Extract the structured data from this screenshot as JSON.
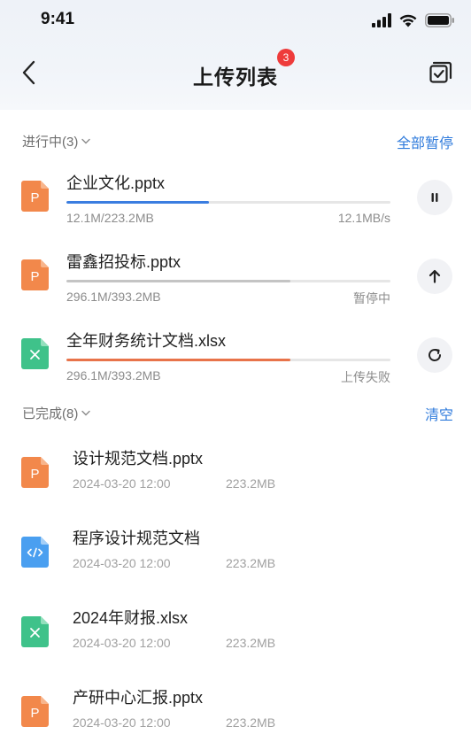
{
  "status_bar": {
    "time": "9:41"
  },
  "header": {
    "title": "上传列表",
    "badge_count": "3"
  },
  "in_progress": {
    "title": "进行中(3)",
    "action": "全部暂停",
    "items": [
      {
        "name": "企业文化.pptx",
        "type": "ppt",
        "size": "12.1M/223.2MB",
        "status": "12.1MB/s",
        "progress": 0.44,
        "bar_color": "#3a7de0",
        "action_icon": "pause-icon"
      },
      {
        "name": "雷鑫招投标.pptx",
        "type": "ppt",
        "size": "296.1M/393.2MB",
        "status": "暂停中",
        "progress": 0.69,
        "bar_color": "#c4c4c4",
        "action_icon": "upload-arrow-icon"
      },
      {
        "name": "全年财务统计文档.xlsx",
        "type": "xls",
        "size": "296.1M/393.2MB",
        "status": "上传失败",
        "progress": 0.69,
        "bar_color": "#e8734a",
        "action_icon": "retry-icon"
      }
    ]
  },
  "completed": {
    "title": "已完成(8)",
    "action": "清空",
    "items": [
      {
        "name": "设计规范文档.pptx",
        "type": "ppt",
        "date": "2024-03-20 12:00",
        "size": "223.2MB"
      },
      {
        "name": "程序设计规范文档",
        "type": "code",
        "date": "2024-03-20 12:00",
        "size": "223.2MB"
      },
      {
        "name": "2024年财报.xlsx",
        "type": "xls",
        "date": "2024-03-20 12:00",
        "size": "223.2MB"
      },
      {
        "name": "产研中心汇报.pptx",
        "type": "ppt",
        "date": "2024-03-20 12:00",
        "size": "223.2MB"
      }
    ]
  },
  "colors": {
    "accent": "#2f7bdc",
    "ppt": "#f2884b",
    "xls": "#3fc28a",
    "code": "#4a9ff0",
    "badge": "#ee3b3b"
  }
}
